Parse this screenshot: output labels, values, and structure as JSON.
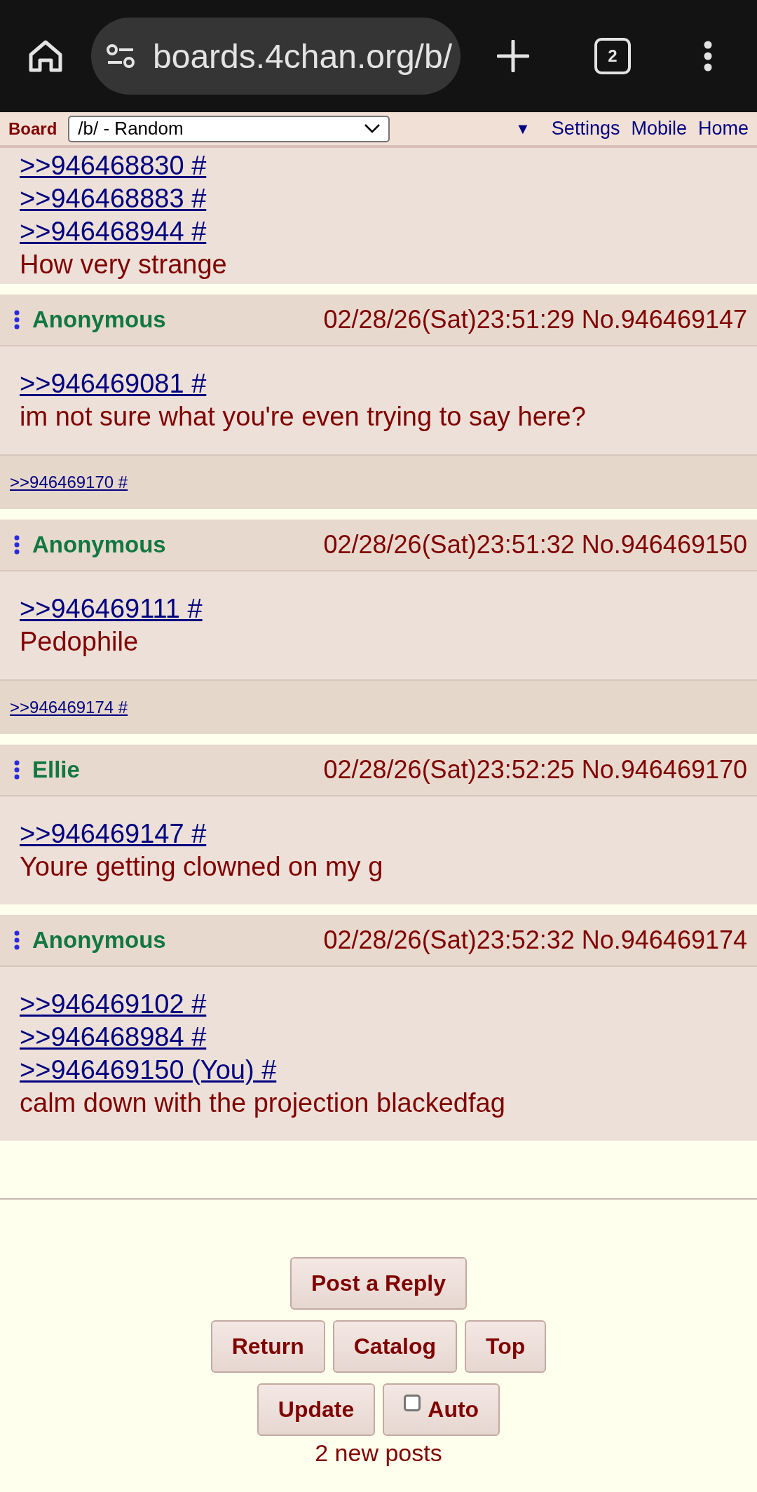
{
  "browser": {
    "url": "boards.4chan.org/b/",
    "tab_count": "2"
  },
  "board_bar": {
    "label": "Board",
    "select": "/b/ - Random",
    "links": [
      {
        "text": "▼",
        "kind": "toggle"
      },
      {
        "text": "Settings",
        "kind": "link"
      },
      {
        "text": "Mobile",
        "kind": "link"
      },
      {
        "text": "Home",
        "kind": "link"
      }
    ]
  },
  "posts": [
    {
      "quotes": [
        ">>946468830 #",
        ">>946468883 #",
        ">>946468944 #"
      ],
      "comment": "How very strange"
    },
    {
      "name": "Anonymous",
      "date": "02/28/26(Sat)23:51:29",
      "number": "No.946469147",
      "quotes": [
        ">>946469081 #"
      ],
      "comment": "im not sure what you're even trying to say here?",
      "backlinks": [
        ">>946469170 #"
      ]
    },
    {
      "name": "Anonymous",
      "date": "02/28/26(Sat)23:51:32",
      "number": "No.946469150",
      "quotes": [
        ">>946469111 #"
      ],
      "comment": "Pedophile",
      "backlinks": [
        ">>946469174 #"
      ]
    },
    {
      "name": "Ellie",
      "date": "02/28/26(Sat)23:52:25",
      "number": "No.946469170",
      "quotes": [
        ">>946469147 #"
      ],
      "comment": "Youre getting clowned on my g"
    },
    {
      "name": "Anonymous",
      "date": "02/28/26(Sat)23:52:32",
      "number": "No.946469174",
      "quotes": [
        ">>946469102 #",
        ">>946468984 #",
        ">>946469150 (You) #"
      ],
      "comment": "calm down with the projection blackedfag"
    }
  ],
  "footer": {
    "rows": [
      [
        {
          "kind": "button",
          "label": "Post a Reply"
        }
      ],
      [
        {
          "kind": "button",
          "label": "Return"
        },
        {
          "kind": "button",
          "label": "Catalog"
        },
        {
          "kind": "button",
          "label": "Top"
        }
      ],
      [
        {
          "kind": "button",
          "label": "Update"
        },
        {
          "kind": "checkbox",
          "label": "Auto",
          "checked": false
        }
      ]
    ],
    "status": "2 new posts"
  }
}
